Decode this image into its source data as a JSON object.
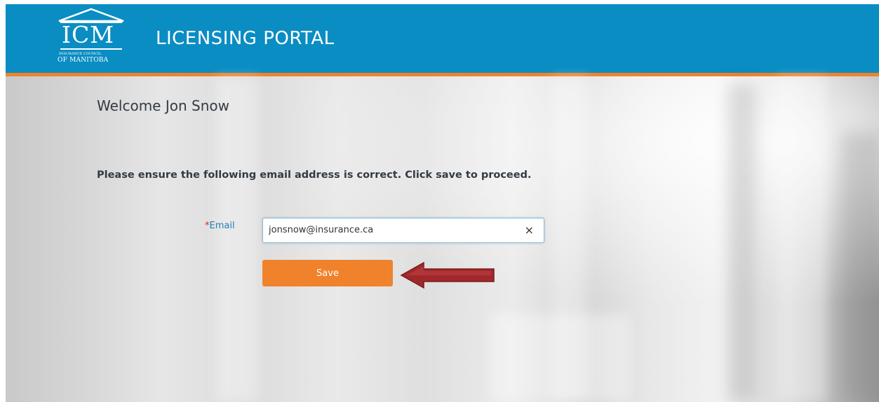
{
  "header": {
    "logo_mark": "ICM",
    "logo_small": "INSURANCE COUNCIL",
    "logo_sub": "OF MANITOBA",
    "title": "LICENSING PORTAL"
  },
  "main": {
    "welcome": "Welcome Jon Snow",
    "instruction": "Please ensure the following email address is correct. Click save to proceed.",
    "email": {
      "required_marker": "*",
      "label": "Email",
      "value": "jonsnow@insurance.ca",
      "clear_icon": "×"
    },
    "save_label": "Save"
  },
  "icons": {
    "clear": "close-icon",
    "pointer": "arrow-left-icon",
    "logo": "building-pediment-icon"
  },
  "colors": {
    "header_bg": "#0a8dc3",
    "header_stripe": "#f0822b",
    "button_bg": "#f0822b",
    "label": "#1f7fb5",
    "required": "#e2231a",
    "arrow": "#a0282b"
  }
}
